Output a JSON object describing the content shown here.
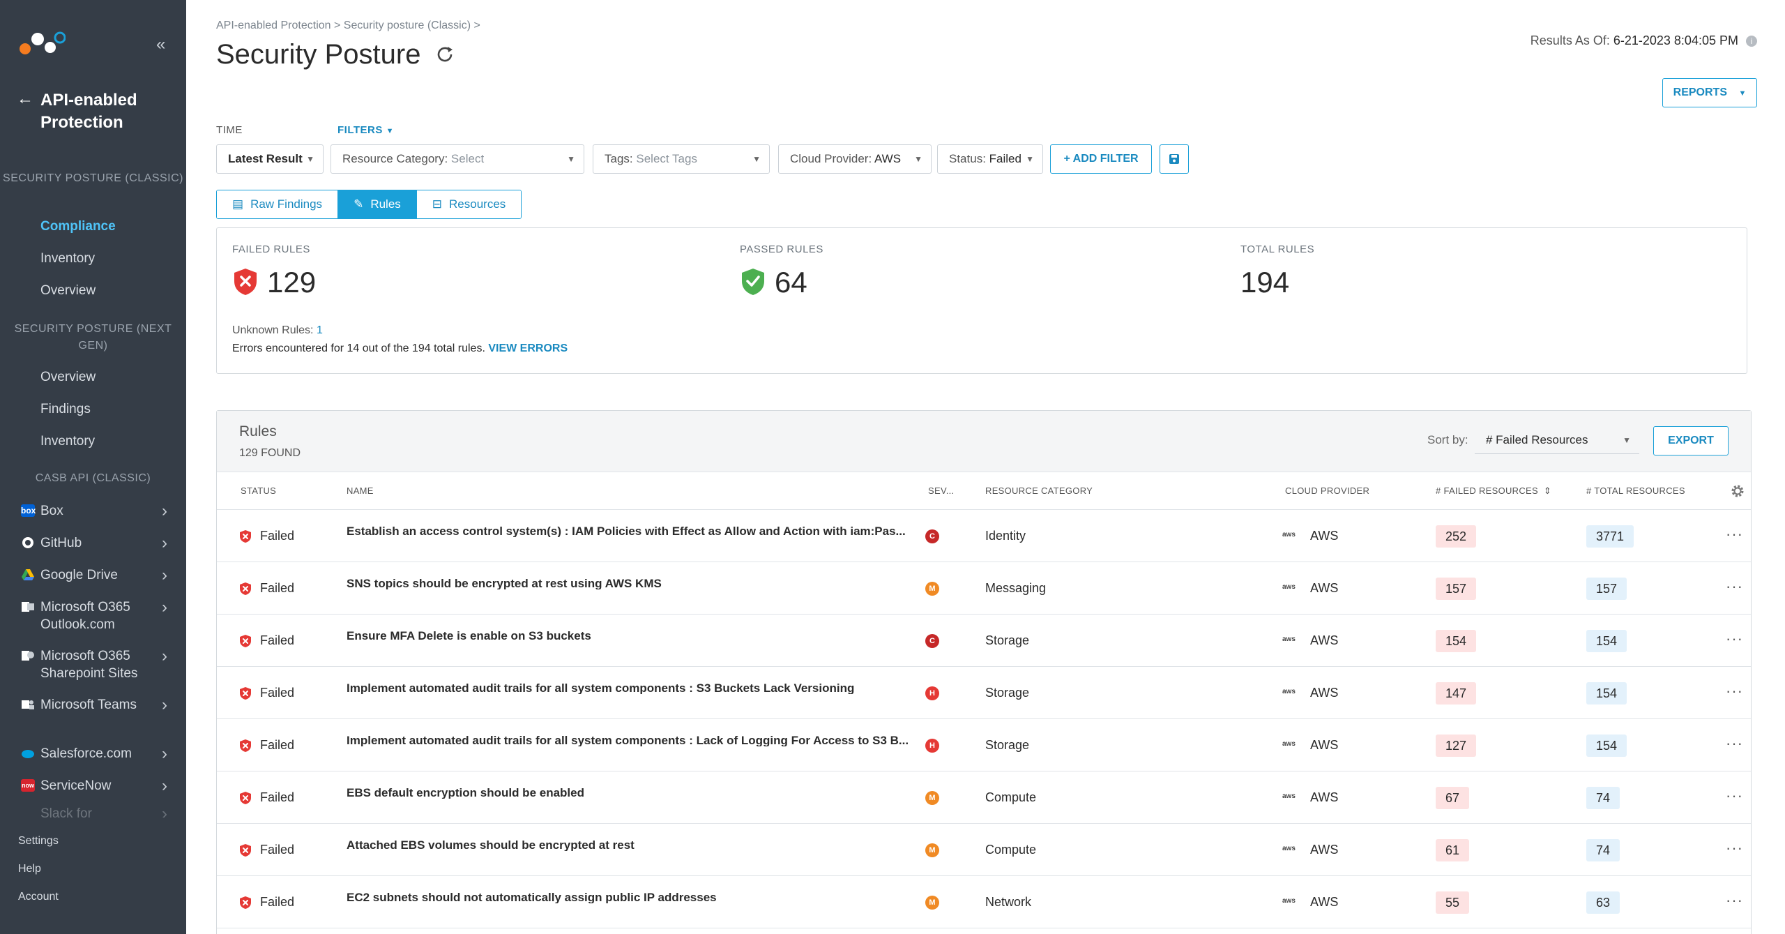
{
  "sidebar": {
    "back_title": "API-enabled Protection",
    "sections": [
      {
        "label": "SECURITY POSTURE (CLASSIC)",
        "items": [
          "Compliance",
          "Inventory",
          "Overview"
        ]
      },
      {
        "label": "SECURITY POSTURE (NEXT GEN)",
        "items": [
          "Overview",
          "Findings",
          "Inventory"
        ]
      },
      {
        "label": "CASB API (CLASSIC)"
      }
    ],
    "apps": [
      {
        "label": "Box",
        "icon": "box-icon",
        "color": "#0061d5",
        "glyph": "box"
      },
      {
        "label": "GitHub",
        "icon": "github-icon"
      },
      {
        "label": "Google Drive",
        "icon": "google-drive-icon"
      },
      {
        "label": "Microsoft O365 Outlook.com",
        "icon": "outlook-icon"
      },
      {
        "label": "Microsoft O365 Sharepoint Sites",
        "icon": "sharepoint-icon"
      },
      {
        "label": "Microsoft Teams",
        "icon": "teams-icon"
      },
      {
        "label": "Salesforce.com",
        "icon": "salesforce-icon",
        "color": "#00a1e0"
      },
      {
        "label": "ServiceNow",
        "icon": "servicenow-icon",
        "color": "#d6242e",
        "glyph": "now"
      },
      {
        "label": "Slack for",
        "icon": "slack-icon"
      }
    ],
    "footer": [
      "Settings",
      "Help",
      "Account"
    ]
  },
  "header": {
    "breadcrumb": "API-enabled Protection > Security posture (Classic) >",
    "title": "Security Posture",
    "results_label": "Results As Of:",
    "results_value": "6-21-2023 8:04:05 PM",
    "reports_label": "REPORTS",
    "info_glyph": "i"
  },
  "filters": {
    "time_label": "TIME",
    "filters_label": "FILTERS",
    "time_value": "Latest Result",
    "resource_category_label": "Resource Category:",
    "resource_category_value": "Select",
    "tags_label": "Tags:",
    "tags_value": "Select Tags",
    "cloud_label": "Cloud Provider:",
    "cloud_value": "AWS",
    "status_label": "Status:",
    "status_value": "Failed",
    "add_filter": "+ ADD FILTER"
  },
  "tabs": [
    "Raw Findings",
    "Rules",
    "Resources"
  ],
  "active_tab": "Rules",
  "summary": {
    "failed_label": "FAILED RULES",
    "failed_value": "129",
    "passed_label": "PASSED RULES",
    "passed_value": "64",
    "total_label": "TOTAL RULES",
    "total_value": "194",
    "unknown_label": "Unknown Rules:",
    "unknown_value": "1",
    "errors_text": "Errors encountered for 14 out of the 194 total rules.",
    "errors_link": "VIEW ERRORS"
  },
  "rules": {
    "title": "Rules",
    "count": "129 FOUND",
    "sort_label": "Sort by:",
    "sort_value": "# Failed Resources",
    "export_label": "EXPORT",
    "columns": [
      "STATUS",
      "NAME",
      "SEV...",
      "RESOURCE CATEGORY",
      "CLOUD PROVIDER",
      "# FAILED RESOURCES",
      "# TOTAL RESOURCES"
    ],
    "rows": [
      {
        "status": "Failed",
        "name": "Establish an access control system(s) : IAM Policies with Effect as Allow and Action with iam:Pas...",
        "sev": "C",
        "category": "Identity",
        "cloud": "AWS",
        "failed": "252",
        "total": "3771"
      },
      {
        "status": "Failed",
        "name": "SNS topics should be encrypted at rest using AWS KMS",
        "sev": "M",
        "category": "Messaging",
        "cloud": "AWS",
        "failed": "157",
        "total": "157"
      },
      {
        "status": "Failed",
        "name": "Ensure MFA Delete is enable on S3 buckets",
        "sev": "C",
        "category": "Storage",
        "cloud": "AWS",
        "failed": "154",
        "total": "154"
      },
      {
        "status": "Failed",
        "name": "Implement automated audit trails for all system components : S3 Buckets Lack Versioning",
        "sev": "H",
        "category": "Storage",
        "cloud": "AWS",
        "failed": "147",
        "total": "154"
      },
      {
        "status": "Failed",
        "name": "Implement automated audit trails for all system components : Lack of Logging For Access to S3 B...",
        "sev": "H",
        "category": "Storage",
        "cloud": "AWS",
        "failed": "127",
        "total": "154"
      },
      {
        "status": "Failed",
        "name": "EBS default encryption should be enabled",
        "sev": "M",
        "category": "Compute",
        "cloud": "AWS",
        "failed": "67",
        "total": "74"
      },
      {
        "status": "Failed",
        "name": "Attached EBS volumes should be encrypted at rest",
        "sev": "M",
        "category": "Compute",
        "cloud": "AWS",
        "failed": "61",
        "total": "74"
      },
      {
        "status": "Failed",
        "name": "EC2 subnets should not automatically assign public IP addresses",
        "sev": "M",
        "category": "Network",
        "cloud": "AWS",
        "failed": "55",
        "total": "63"
      }
    ]
  },
  "colors": {
    "accent": "#1aa0d8",
    "sev_C": "#c62828",
    "sev_H": "#e53935",
    "sev_M": "#f08a24",
    "fail": "#e53935",
    "pass": "#4caf50"
  }
}
